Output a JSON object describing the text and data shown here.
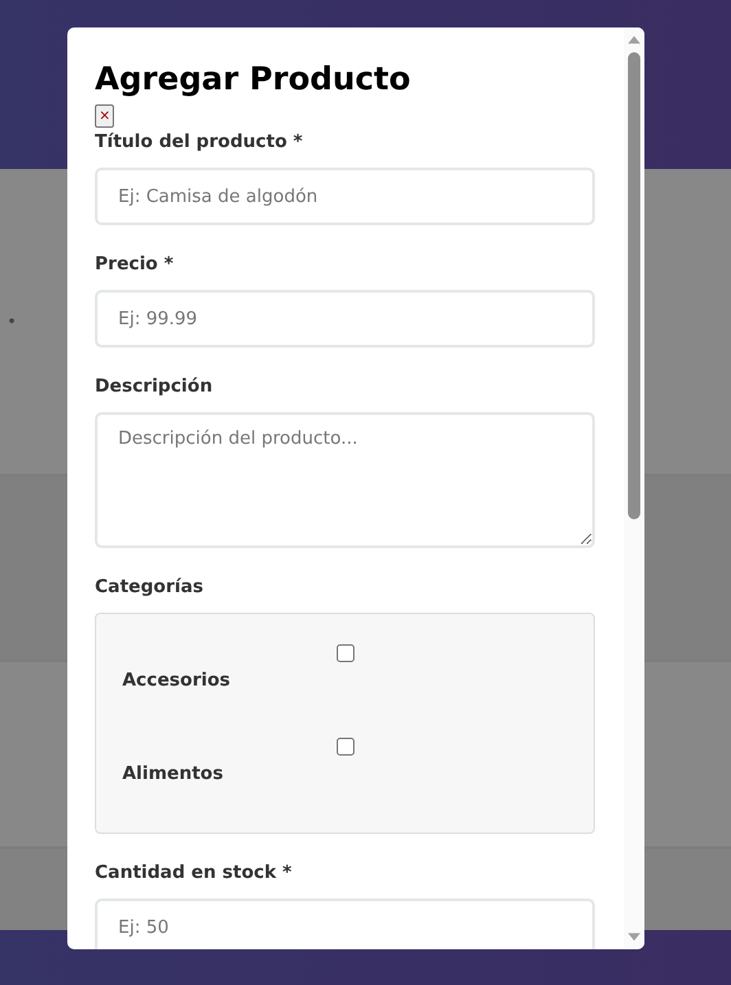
{
  "background": {
    "bullet": "•"
  },
  "modal": {
    "title": "Agregar Producto",
    "close": "×",
    "fields": [
      {
        "kind": "input",
        "label": "Título del producto *",
        "placeholder": "Ej: Camisa de algodón"
      },
      {
        "kind": "input",
        "label": "Precio *",
        "placeholder": "Ej: 99.99"
      },
      {
        "kind": "textarea",
        "label": "Descripción",
        "placeholder": "Descripción del producto..."
      },
      {
        "kind": "checkboxes",
        "label": "Categorías",
        "options": [
          {
            "label": "Accesorios",
            "checked": false
          },
          {
            "label": "Alimentos",
            "checked": false
          }
        ]
      },
      {
        "kind": "input",
        "label": "Cantidad en stock *",
        "placeholder": "Ej: 50"
      }
    ]
  }
}
